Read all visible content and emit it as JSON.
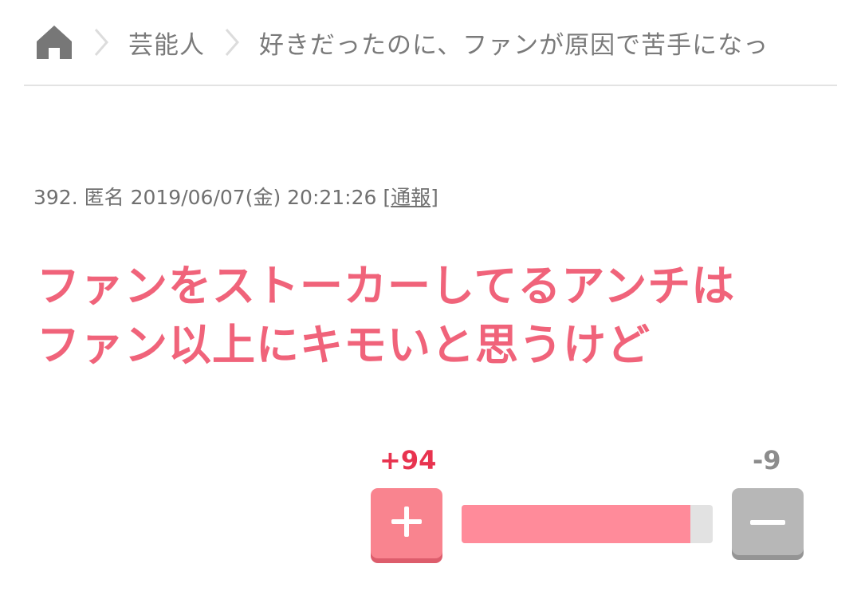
{
  "breadcrumb": {
    "home_icon": "home-icon",
    "separator_icon": "chevron-right-icon",
    "category": "芸能人",
    "current": "好きだったのに、ファンが原因で苦手になっ"
  },
  "post": {
    "number": "392.",
    "author": "匿名",
    "datetime": "2019/06/07(金) 20:21:26",
    "report_open": "[",
    "report_label": "通報",
    "report_close": "]",
    "body_line1": "ファンをストーカーしてるアンチは",
    "body_line2": "ファン以上にキモいと思うけど"
  },
  "votes": {
    "plus_count": "+94",
    "minus_count": "-9",
    "plus_ratio": 0.912,
    "plus_icon": "plus-icon",
    "minus_icon": "minus-icon"
  },
  "colors": {
    "accent": "#f0637a",
    "plus": "#f9848f",
    "minus": "#b7b7b7"
  }
}
